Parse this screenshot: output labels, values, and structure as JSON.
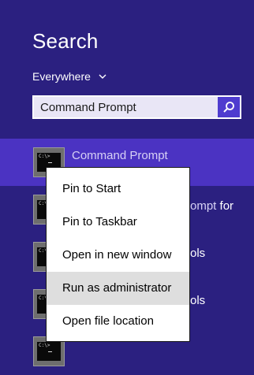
{
  "search": {
    "title": "Search",
    "scope_label": "Everywhere",
    "query": "Command Prompt"
  },
  "results": [
    {
      "label": "Command Prompt",
      "selected": true
    },
    {
      "label": "",
      "tail": "ompt for",
      "selected": false
    },
    {
      "label": "",
      "tail": "ols",
      "selected": false
    },
    {
      "label": "",
      "tail": "ols",
      "selected": false
    },
    {
      "label": "",
      "tail": "",
      "selected": false
    }
  ],
  "context_menu": {
    "items": [
      {
        "label": "Pin to Start"
      },
      {
        "label": "Pin to Taskbar"
      },
      {
        "label": "Open in new window"
      },
      {
        "label": "Run as administrator",
        "hovered": true
      },
      {
        "label": "Open file location"
      }
    ]
  },
  "icons": {
    "scope_chevron": "chevron-down-icon",
    "search_button": "search-icon",
    "result_icon": "command-prompt-icon"
  },
  "colors": {
    "background": "#2b2080",
    "selected_row": "#4b33c2",
    "search_button": "#4f3ccf",
    "menu_hover": "#dedede"
  }
}
